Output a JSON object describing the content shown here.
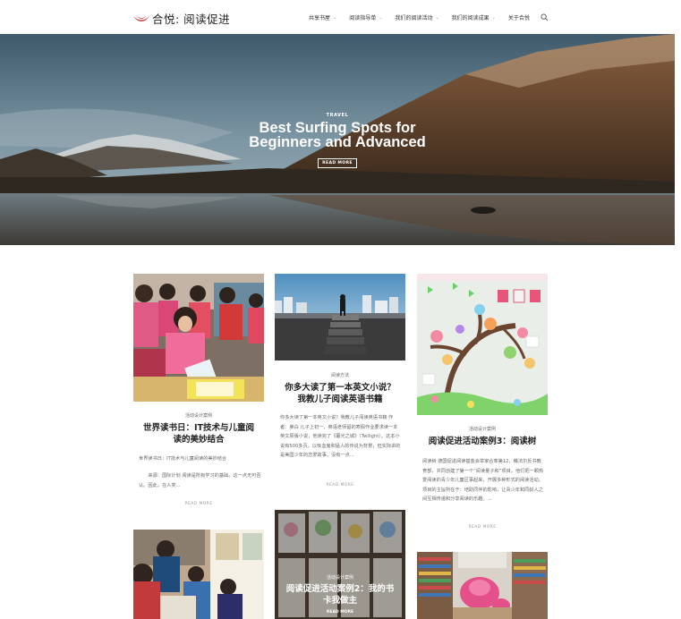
{
  "header": {
    "logo_text": "合悦: 阅读促进",
    "nav": [
      {
        "label": "共享书屋",
        "caret": true
      },
      {
        "label": "阅读指导单",
        "caret": true
      },
      {
        "label": "我们的阅读活动",
        "caret": true
      },
      {
        "label": "我们的阅读成果",
        "caret": true
      },
      {
        "label": "关于合悦",
        "caret": false
      }
    ]
  },
  "hero": {
    "category": "TRAVEL",
    "title_line1": "Best Surfing Spots for",
    "title_line2": "Beginners and Advanced",
    "button": "READ MORE"
  },
  "cards": [
    {
      "category": "活动设计案例",
      "title": "世界读书日：IT技术与儿童阅读的美妙结合",
      "excerpt1": "世界读书日：IT技术与儿童阅读的美妙结合",
      "excerpt2": "来源：国际计划 阅读是所有学习的基础。这一点无可否认。因此，在人类...",
      "more": "READ MORE"
    },
    {
      "category": "阅读方法",
      "title": "你多大读了第一本英文小说？我教儿子阅读英语书籍",
      "excerpt": "你多大读了第一本英文小说？我教儿子阅读英语书籍 作者：莱白 儿子上初一，英语老师留的寒假作业要求读一本英文原版小说，他读完了《暮光之城》（Twilight）。这本小说有500多页，以吸血鬼和猛人的传说为背景，但实际讲的是美国少年的恋爱故事，没有一点...",
      "more": "READ MORE"
    },
    {
      "category": "活动设计案例",
      "title": "阅读促进活动案例3：阅读树",
      "excerpt": "阅读树 德国促进阅读基金会举家合率第12，藉法尔反书教育部，共同创建了第一个“阅读量子和”项目。他们把一颗热爱阅读的青少年儿童区事起来，开展多种形式的阅读活动。项目的主旨所在于：培助同伴的影响，让青少年和同龄人之间互相传递和分享阅读的乐趣。...",
      "more": "READ MORE"
    },
    {
      "category": "活动设计案例",
      "title": "阅读促进活动案例2：我的书卡我做主",
      "more": "READ MORE"
    }
  ],
  "colors": {
    "logo_red": "#d9323b",
    "hero_sky": "#5f7f93",
    "accent_text": "#222222"
  }
}
